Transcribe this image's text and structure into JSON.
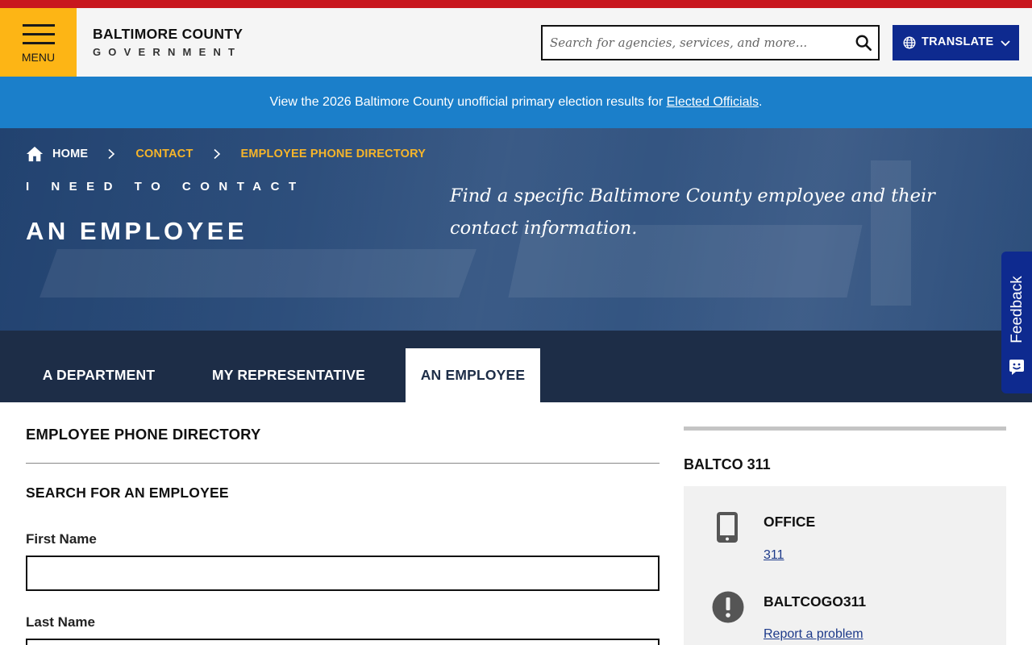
{
  "header": {
    "menu_label": "MENU",
    "brand_name": "BALTIMORE COUNTY",
    "brand_sub": "GOVERNMENT",
    "search_placeholder": "Search for agencies, services, and more...",
    "translate_label": "TRANSLATE",
    "colors": {
      "top_stripe": "#c8171e",
      "menu_bg": "#fdb515",
      "translate_bg": "#0e2a8f"
    }
  },
  "alert": {
    "text": "View the 2026 Baltimore County unofficial primary election results for ",
    "link": "Elected Officials",
    "suffix": ".",
    "color": "#1b7fca"
  },
  "breadcrumb": {
    "home": "HOME",
    "items": [
      "CONTACT",
      "EMPLOYEE PHONE DIRECTORY"
    ]
  },
  "hero": {
    "kicker": "I NEED TO CONTACT",
    "title": "AN EMPLOYEE",
    "description": "Find a specific Baltimore County employee and their contact information."
  },
  "tabs": [
    {
      "label": "A DEPARTMENT",
      "active": false
    },
    {
      "label": "MY REPRESENTATIVE",
      "active": false
    },
    {
      "label": "AN EMPLOYEE",
      "active": true
    }
  ],
  "feedback": {
    "label": "Feedback"
  },
  "directory": {
    "title": "EMPLOYEE PHONE DIRECTORY",
    "search_title": "SEARCH FOR AN EMPLOYEE",
    "first_name_label": "First Name",
    "first_name_value": "",
    "last_name_label": "Last Name",
    "last_name_value": ""
  },
  "sidebar": {
    "title": "BALTCO 311",
    "contacts": [
      {
        "label": "OFFICE",
        "link": "311",
        "icon": "mobile-phone-icon"
      },
      {
        "label": "BALTCOGO311",
        "link": "Report a problem",
        "icon": "exclamation-icon"
      }
    ]
  }
}
